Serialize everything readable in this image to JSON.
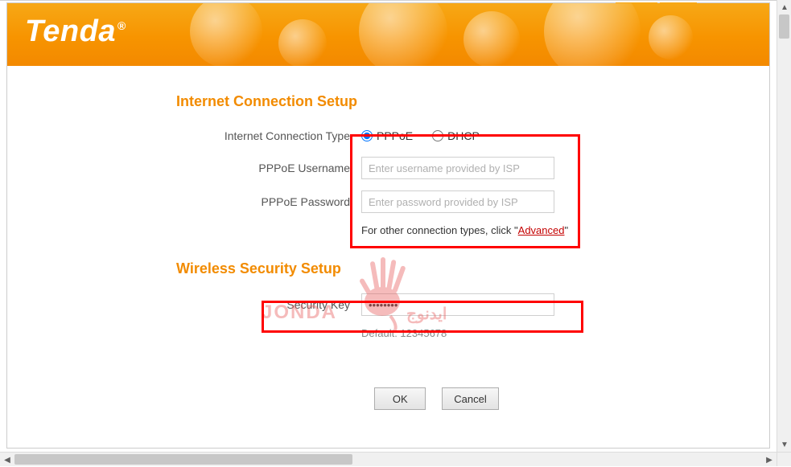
{
  "brand": {
    "name": "Tenda",
    "reg": "®"
  },
  "sections": {
    "internet": {
      "title": "Internet Connection Setup",
      "type_label": "Internet Connection Type",
      "radios": {
        "pppoe": "PPPoE",
        "dhcp": "DHCP",
        "selected": "pppoe"
      },
      "username_label": "PPPoE Username",
      "username_placeholder": "Enter username provided by ISP",
      "username_value": "",
      "password_label": "PPPoE Password",
      "password_placeholder": "Enter password provided by ISP",
      "password_value": "",
      "hint_prefix": "For other connection types, click \"",
      "hint_link": "Advanced",
      "hint_suffix": "\""
    },
    "wireless": {
      "title": "Wireless Security Setup",
      "key_label": "Security Key",
      "key_value": "••••••••",
      "default_label": "Default: 12345678"
    }
  },
  "buttons": {
    "ok": "OK",
    "cancel": "Cancel"
  },
  "watermark": {
    "left": "JONDA",
    "right": "ايدنوج"
  }
}
